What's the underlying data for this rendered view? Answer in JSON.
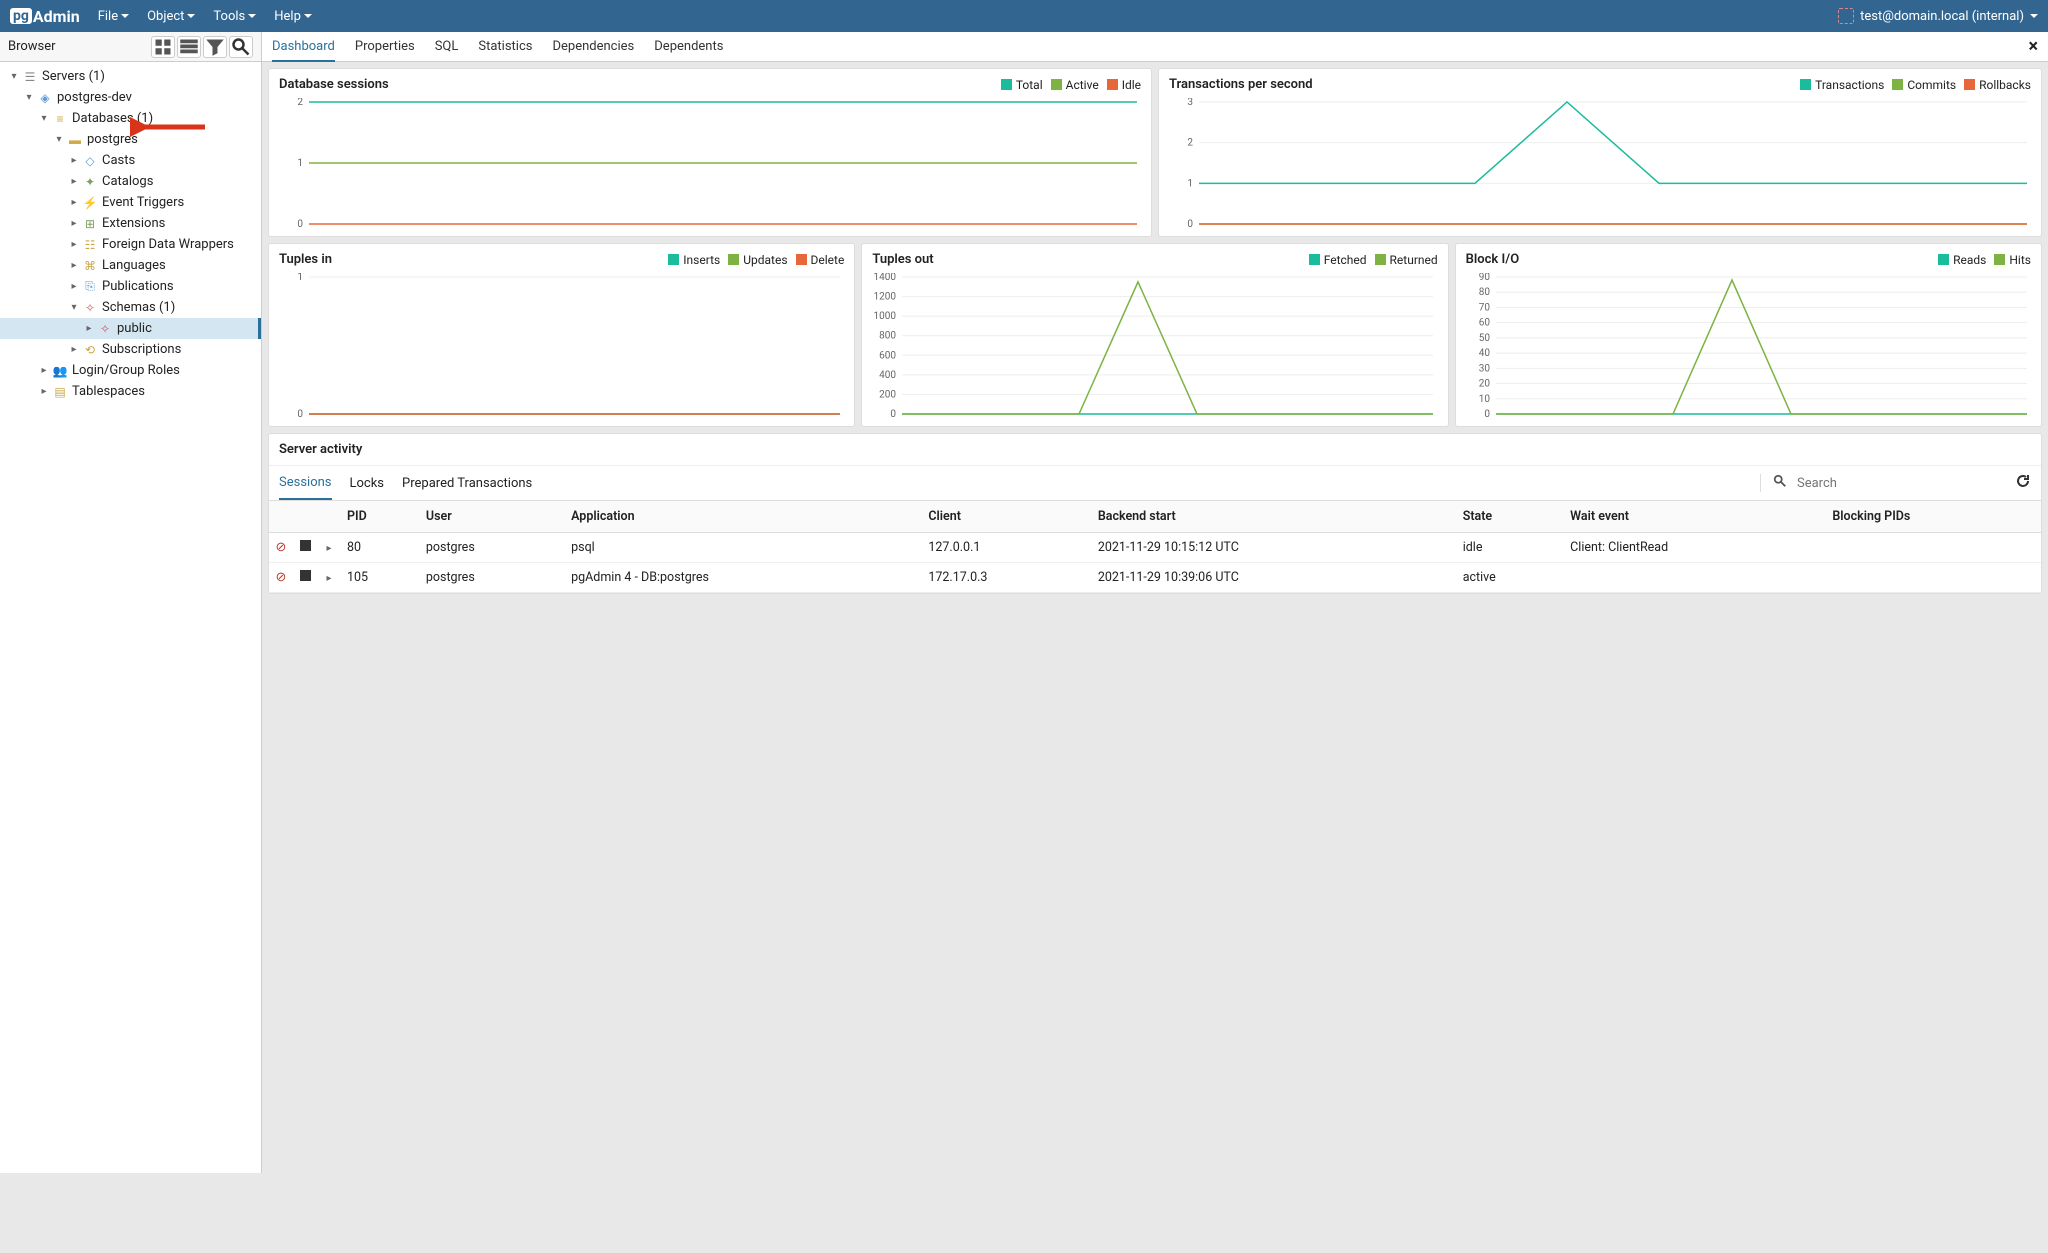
{
  "app": {
    "name": "Admin",
    "prefix": "pg"
  },
  "menu": {
    "file": "File",
    "object": "Object",
    "tools": "Tools",
    "help": "Help"
  },
  "user": {
    "label": "test@domain.local (internal)"
  },
  "browser": {
    "title": "Browser"
  },
  "tree": {
    "servers": "Servers (1)",
    "server_node": "postgres-dev",
    "databases": "Databases (1)",
    "db_postgres": "postgres",
    "casts": "Casts",
    "catalogs": "Catalogs",
    "event_triggers": "Event Triggers",
    "extensions": "Extensions",
    "fdw": "Foreign Data Wrappers",
    "languages": "Languages",
    "publications": "Publications",
    "schemas": "Schemas (1)",
    "public": "public",
    "subscriptions": "Subscriptions",
    "login_roles": "Login/Group Roles",
    "tablespaces": "Tablespaces"
  },
  "tabs": {
    "dashboard": "Dashboard",
    "properties": "Properties",
    "sql": "SQL",
    "statistics": "Statistics",
    "dependencies": "Dependencies",
    "dependents": "Dependents"
  },
  "charts": {
    "db_sessions": {
      "title": "Database sessions",
      "legend": {
        "total": "Total",
        "active": "Active",
        "idle": "Idle"
      }
    },
    "tps": {
      "title": "Transactions per second",
      "legend": {
        "transactions": "Transactions",
        "commits": "Commits",
        "rollbacks": "Rollbacks"
      }
    },
    "tuples_in": {
      "title": "Tuples in",
      "legend": {
        "inserts": "Inserts",
        "updates": "Updates",
        "delete": "Delete"
      }
    },
    "tuples_out": {
      "title": "Tuples out",
      "legend": {
        "fetched": "Fetched",
        "returned": "Returned"
      }
    },
    "block_io": {
      "title": "Block I/O",
      "legend": {
        "reads": "Reads",
        "hits": "Hits"
      }
    }
  },
  "activity": {
    "title": "Server activity",
    "tabs": {
      "sessions": "Sessions",
      "locks": "Locks",
      "prepared": "Prepared Transactions"
    },
    "search_placeholder": "Search",
    "columns": {
      "pid": "PID",
      "user": "User",
      "application": "Application",
      "client": "Client",
      "backend_start": "Backend start",
      "state": "State",
      "wait_event": "Wait event",
      "blocking_pids": "Blocking PIDs"
    },
    "rows": [
      {
        "pid": "80",
        "user": "postgres",
        "application": "psql",
        "client": "127.0.0.1",
        "backend_start": "2021-11-29 10:15:12 UTC",
        "state": "idle",
        "wait_event": "Client: ClientRead",
        "blocking_pids": ""
      },
      {
        "pid": "105",
        "user": "postgres",
        "application": "pgAdmin 4 - DB:postgres",
        "client": "172.17.0.3",
        "backend_start": "2021-11-29 10:39:06 UTC",
        "state": "active",
        "wait_event": "",
        "blocking_pids": ""
      }
    ]
  },
  "chart_data": [
    {
      "id": "db_sessions",
      "type": "line",
      "ylim": [
        0,
        2
      ],
      "yticks": [
        0,
        1,
        2
      ],
      "series": [
        {
          "name": "Total",
          "color": "#1abc9c",
          "values": [
            2,
            2,
            2,
            2,
            2,
            2,
            2,
            2,
            2,
            2
          ]
        },
        {
          "name": "Active",
          "color": "#7cb342",
          "values": [
            1,
            1,
            1,
            1,
            1,
            1,
            1,
            1,
            1,
            1
          ]
        },
        {
          "name": "Idle",
          "color": "#e8673a",
          "values": [
            0,
            0,
            0,
            0,
            0,
            0,
            0,
            0,
            0,
            0
          ]
        }
      ]
    },
    {
      "id": "tps",
      "type": "line",
      "ylim": [
        0,
        3
      ],
      "yticks": [
        0,
        1,
        2,
        3
      ],
      "series": [
        {
          "name": "Transactions",
          "color": "#1abc9c",
          "values": [
            1,
            1,
            1,
            1,
            3,
            1,
            1,
            1,
            1,
            1
          ]
        },
        {
          "name": "Commits",
          "color": "#7cb342",
          "values": [
            0,
            0,
            0,
            0,
            0,
            0,
            0,
            0,
            0,
            0
          ]
        },
        {
          "name": "Rollbacks",
          "color": "#e8673a",
          "values": [
            0,
            0,
            0,
            0,
            0,
            0,
            0,
            0,
            0,
            0
          ]
        }
      ]
    },
    {
      "id": "tuples_in",
      "type": "line",
      "ylim": [
        0,
        1
      ],
      "yticks": [
        0,
        1
      ],
      "series": [
        {
          "name": "Inserts",
          "color": "#1abc9c",
          "values": [
            0,
            0,
            0,
            0,
            0,
            0,
            0,
            0,
            0,
            0
          ]
        },
        {
          "name": "Updates",
          "color": "#7cb342",
          "values": [
            0,
            0,
            0,
            0,
            0,
            0,
            0,
            0,
            0,
            0
          ]
        },
        {
          "name": "Delete",
          "color": "#e8673a",
          "values": [
            0,
            0,
            0,
            0,
            0,
            0,
            0,
            0,
            0,
            0
          ]
        }
      ]
    },
    {
      "id": "tuples_out",
      "type": "line",
      "ylim": [
        0,
        1400
      ],
      "yticks": [
        0,
        200,
        400,
        600,
        800,
        1000,
        1200,
        1400
      ],
      "series": [
        {
          "name": "Fetched",
          "color": "#1abc9c",
          "values": [
            0,
            0,
            0,
            0,
            0,
            0,
            0,
            0,
            0,
            0
          ]
        },
        {
          "name": "Returned",
          "color": "#7cb342",
          "values": [
            0,
            0,
            0,
            0,
            1350,
            0,
            0,
            0,
            0,
            0
          ]
        }
      ]
    },
    {
      "id": "block_io",
      "type": "line",
      "ylim": [
        0,
        90
      ],
      "yticks": [
        0,
        10,
        20,
        30,
        40,
        50,
        60,
        70,
        80,
        90
      ],
      "series": [
        {
          "name": "Reads",
          "color": "#1abc9c",
          "values": [
            0,
            0,
            0,
            0,
            0,
            0,
            0,
            0,
            0,
            0
          ]
        },
        {
          "name": "Hits",
          "color": "#7cb342",
          "values": [
            0,
            0,
            0,
            0,
            88,
            0,
            0,
            0,
            0,
            0
          ]
        }
      ]
    }
  ],
  "colors": {
    "teal": "#1abc9c",
    "green": "#7cb342",
    "orange": "#e8673a",
    "header": "#326690",
    "active": "#2b709b"
  }
}
